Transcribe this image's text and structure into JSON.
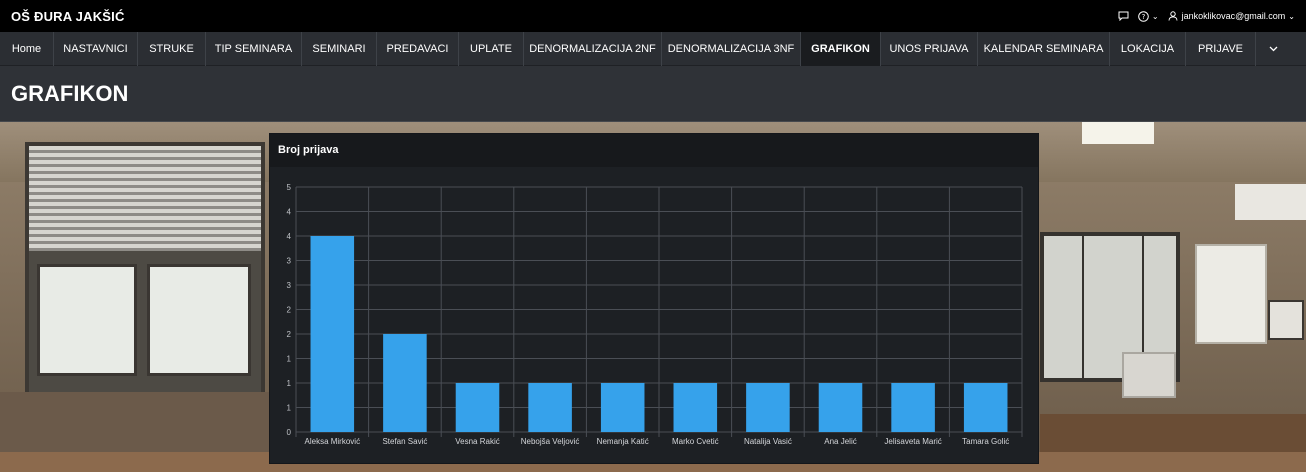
{
  "app": {
    "brand": "OŠ ĐURA JAKŠIĆ"
  },
  "topbar": {
    "email": "jankoklikovac@gmail.com",
    "chat_icon": "chat-bubble-icon",
    "help_icon": "help-circle-icon",
    "user_icon": "user-icon"
  },
  "nav": {
    "items": [
      {
        "label": "Home"
      },
      {
        "label": "NASTAVNICI"
      },
      {
        "label": "STRUKE"
      },
      {
        "label": "TIP SEMINARA"
      },
      {
        "label": "SEMINARI"
      },
      {
        "label": "PREDAVACI"
      },
      {
        "label": "UPLATE"
      },
      {
        "label": "DENORMALIZACIJA 2NF"
      },
      {
        "label": "DENORMALIZACIJA 3NF"
      },
      {
        "label": "GRAFIKON",
        "active": true
      },
      {
        "label": "UNOS PRIJAVA"
      },
      {
        "label": "KALENDAR SEMINARA"
      },
      {
        "label": "LOKACIJA"
      },
      {
        "label": "PRIJAVE"
      }
    ],
    "more_icon": "chevron-down-icon"
  },
  "page": {
    "title": "GRAFIKON"
  },
  "chart": {
    "header": "Broj prijava"
  },
  "chart_data": {
    "type": "bar",
    "title": "Broj prijava",
    "categories": [
      "Aleksa Mirković",
      "Stefan Savić",
      "Vesna Rakić",
      "Nebojša Veljović",
      "Nemanja Katić",
      "Marko Cvetić",
      "Natalija Vasić",
      "Ana Jelić",
      "Jelisaveta Marić",
      "Tamara Golić"
    ],
    "values": [
      4,
      2,
      1,
      1,
      1,
      1,
      1,
      1,
      1,
      1
    ],
    "y_tick_labels": [
      "0",
      "1",
      "1",
      "1",
      "2",
      "2",
      "3",
      "3",
      "4",
      "4",
      "5"
    ],
    "ylim": [
      0,
      5
    ],
    "grid": true,
    "bar_color": "#36a2eb"
  }
}
